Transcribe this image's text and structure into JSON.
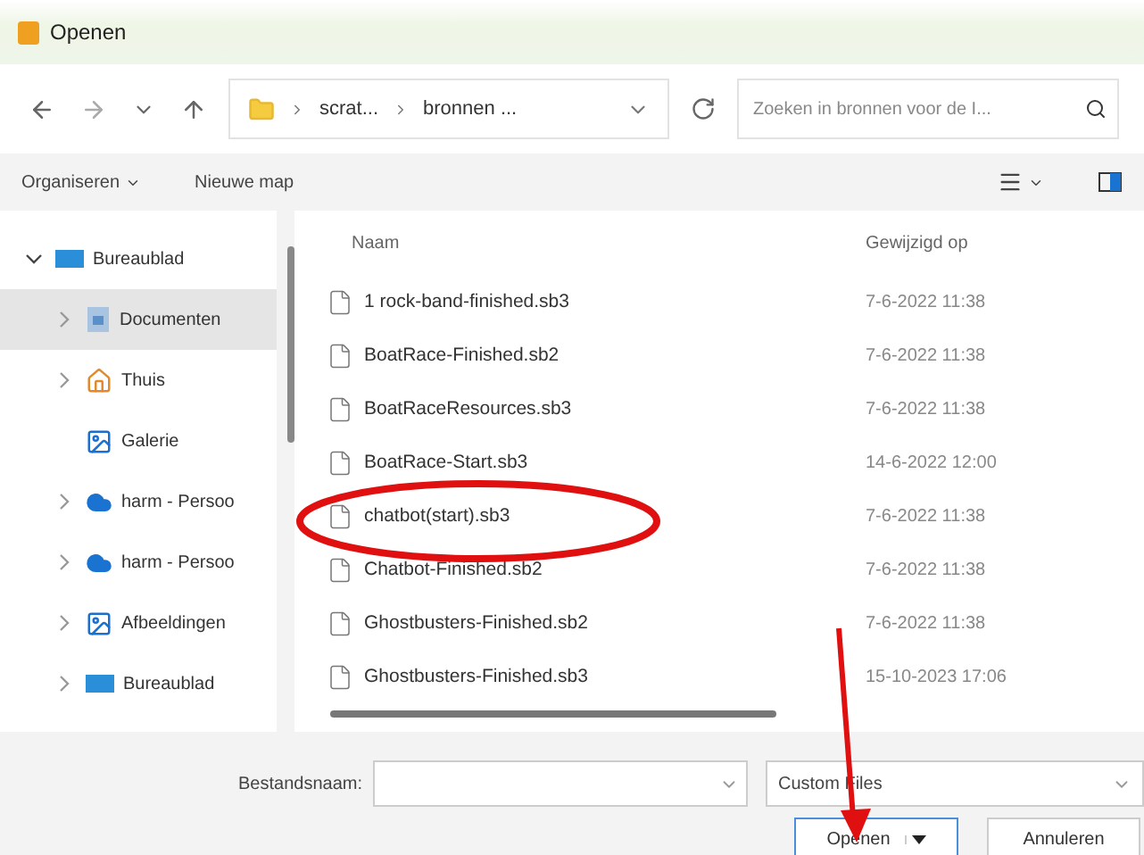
{
  "window": {
    "title": "Openen"
  },
  "nav": {
    "path": [
      "scrat...",
      "bronnen ..."
    ],
    "search": {
      "placeholder": "Zoeken in bronnen voor de I..."
    }
  },
  "toolbar": {
    "organize": "Organiseren",
    "new_folder": "Nieuwe map"
  },
  "sidebar": {
    "items": [
      {
        "label": "Bureaublad",
        "kind": "desktop",
        "expandable": true,
        "expanded": true,
        "selected": false,
        "children": [
          {
            "label": "Documenten",
            "kind": "documents",
            "expandable": true,
            "expanded": false,
            "selected": true
          },
          {
            "label": "Thuis",
            "kind": "home",
            "expandable": true,
            "expanded": false,
            "selected": false
          },
          {
            "label": "Galerie",
            "kind": "gallery",
            "expandable": false,
            "selected": false
          },
          {
            "label": "harm - Persoo",
            "kind": "cloud",
            "expandable": true,
            "expanded": false,
            "selected": false
          },
          {
            "label": "harm - Persoo",
            "kind": "cloud",
            "expandable": true,
            "expanded": false,
            "selected": false
          },
          {
            "label": "Afbeeldingen",
            "kind": "pictures",
            "expandable": true,
            "expanded": false,
            "selected": false
          },
          {
            "label": "Bureaublad",
            "kind": "desktop",
            "expandable": true,
            "expanded": false,
            "selected": false
          }
        ]
      }
    ]
  },
  "table": {
    "columns": [
      "Naam",
      "Gewijzigd op"
    ],
    "rows": [
      {
        "name": "1 rock-band-finished.sb3",
        "modified": "7-6-2022 11:38",
        "circled": false
      },
      {
        "name": "BoatRace-Finished.sb2",
        "modified": "7-6-2022 11:38",
        "circled": false
      },
      {
        "name": "BoatRaceResources.sb3",
        "modified": "7-6-2022 11:38",
        "circled": false
      },
      {
        "name": "BoatRace-Start.sb3",
        "modified": "14-6-2022 12:00",
        "circled": false
      },
      {
        "name": "chatbot(start).sb3",
        "modified": "7-6-2022 11:38",
        "circled": true
      },
      {
        "name": "Chatbot-Finished.sb2",
        "modified": "7-6-2022 11:38",
        "circled": false
      },
      {
        "name": "Ghostbusters-Finished.sb2",
        "modified": "7-6-2022 11:38",
        "circled": false
      },
      {
        "name": "Ghostbusters-Finished.sb3",
        "modified": "15-10-2023 17:06",
        "circled": false
      }
    ]
  },
  "footer": {
    "filename_label": "Bestandsnaam:",
    "filter": "Custom Files",
    "open": "Openen",
    "cancel": "Annuleren"
  }
}
